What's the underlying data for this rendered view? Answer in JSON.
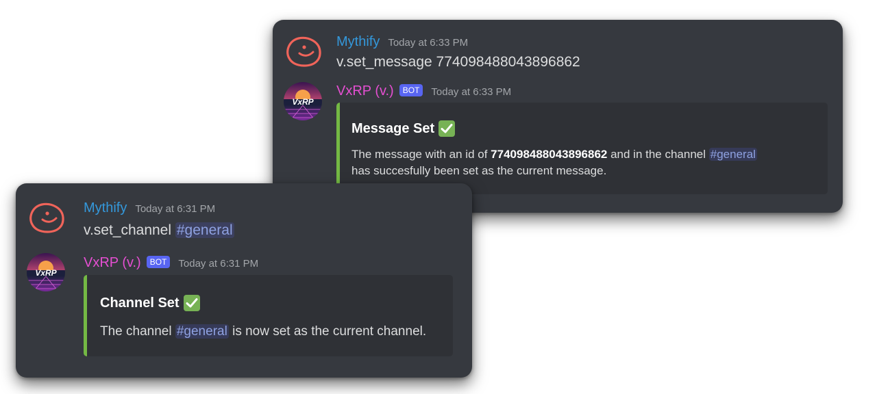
{
  "back_panel": {
    "user_message": {
      "username": "Mythify",
      "timestamp": "Today at 6:33 PM",
      "text": "v.set_message 774098488043896862"
    },
    "bot_message": {
      "username": "VxRP (v.)",
      "bot_tag": "BOT",
      "timestamp": "Today at 6:33 PM",
      "embed": {
        "title": "Message Set",
        "desc_prefix": "The message with an id of ",
        "desc_id": "774098488043896862",
        "desc_middle": " and in the channel ",
        "desc_mention": "#general",
        "desc_suffix": "has succesfully been set as the current message."
      }
    }
  },
  "front_panel": {
    "user_message": {
      "username": "Mythify",
      "timestamp": "Today at 6:31 PM",
      "text": "v.set_channel ",
      "mention": "#general"
    },
    "bot_message": {
      "username": "VxRP (v.)",
      "bot_tag": "BOT",
      "timestamp": "Today at 6:31 PM",
      "embed": {
        "title": "Channel Set",
        "desc_prefix": "The channel ",
        "desc_mention": "#general",
        "desc_suffix": " is now set as the current channel."
      }
    }
  },
  "colors": {
    "background": "#36393f",
    "embed_background": "#2f3136",
    "embed_accent": "#74b944",
    "user_name": "#3498db",
    "bot_name": "#e54fd2",
    "bot_tag": "#5865f2",
    "mention": "#8ea1e1"
  }
}
